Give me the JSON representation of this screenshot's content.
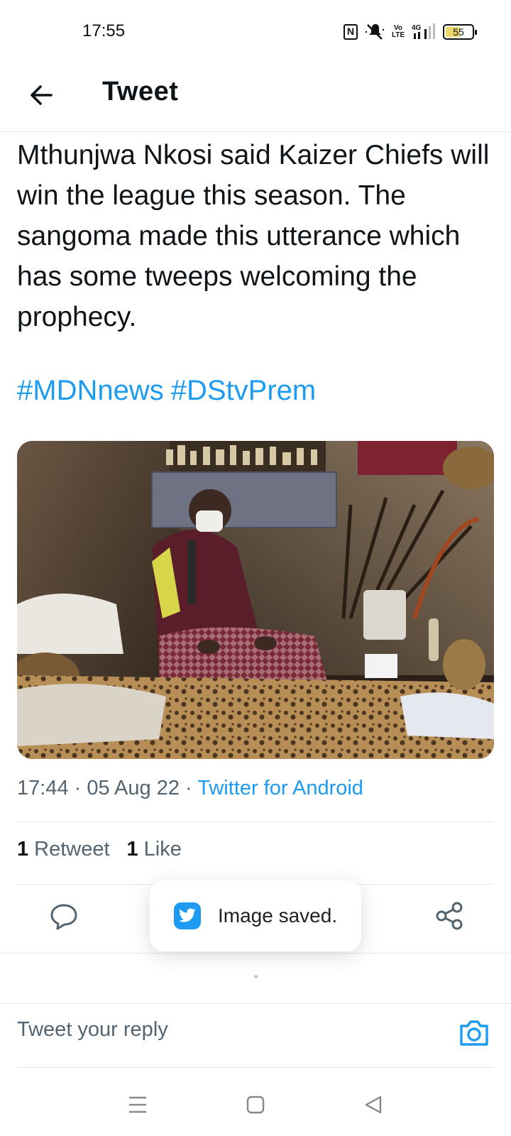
{
  "status_bar": {
    "time": "17:55",
    "volte": "Vo\nLTE",
    "network": "4G",
    "battery": "55",
    "icons": [
      "nfc-icon",
      "mute-icon",
      "volte-icon",
      "signal-icon",
      "battery-icon"
    ]
  },
  "header": {
    "title": "Tweet",
    "back_icon": "arrow-left-icon"
  },
  "tweet": {
    "text": "Mthunjwa Nkosi said Kaizer Chiefs will win the league this season. The sangoma made this utterance which has some tweeps welcoming the prophecy.",
    "hashtags": [
      "#MDNnews",
      "#DStvPrem"
    ],
    "image_description_icon": "photo",
    "timestamp": "17:44 · 05 Aug 22 · ",
    "source": "Twitter for Android"
  },
  "stats": {
    "retweets_count": "1",
    "retweets_label": "Retweet",
    "likes_count": "1",
    "likes_label": "Like"
  },
  "actions": {
    "reply_icon": "reply-icon",
    "share_icon": "share-icon"
  },
  "toast": {
    "text": "Image saved.",
    "icon": "twitter-bird-icon"
  },
  "reply": {
    "placeholder": "Tweet your reply",
    "camera_icon": "camera-icon"
  },
  "nav": {
    "icons": [
      "menu-icon",
      "home-square-icon",
      "back-triangle-icon"
    ]
  },
  "colors": {
    "accent": "#1d9bf0",
    "text": "#0f1419",
    "secondary": "#536471",
    "divider": "#e4e6e8"
  }
}
